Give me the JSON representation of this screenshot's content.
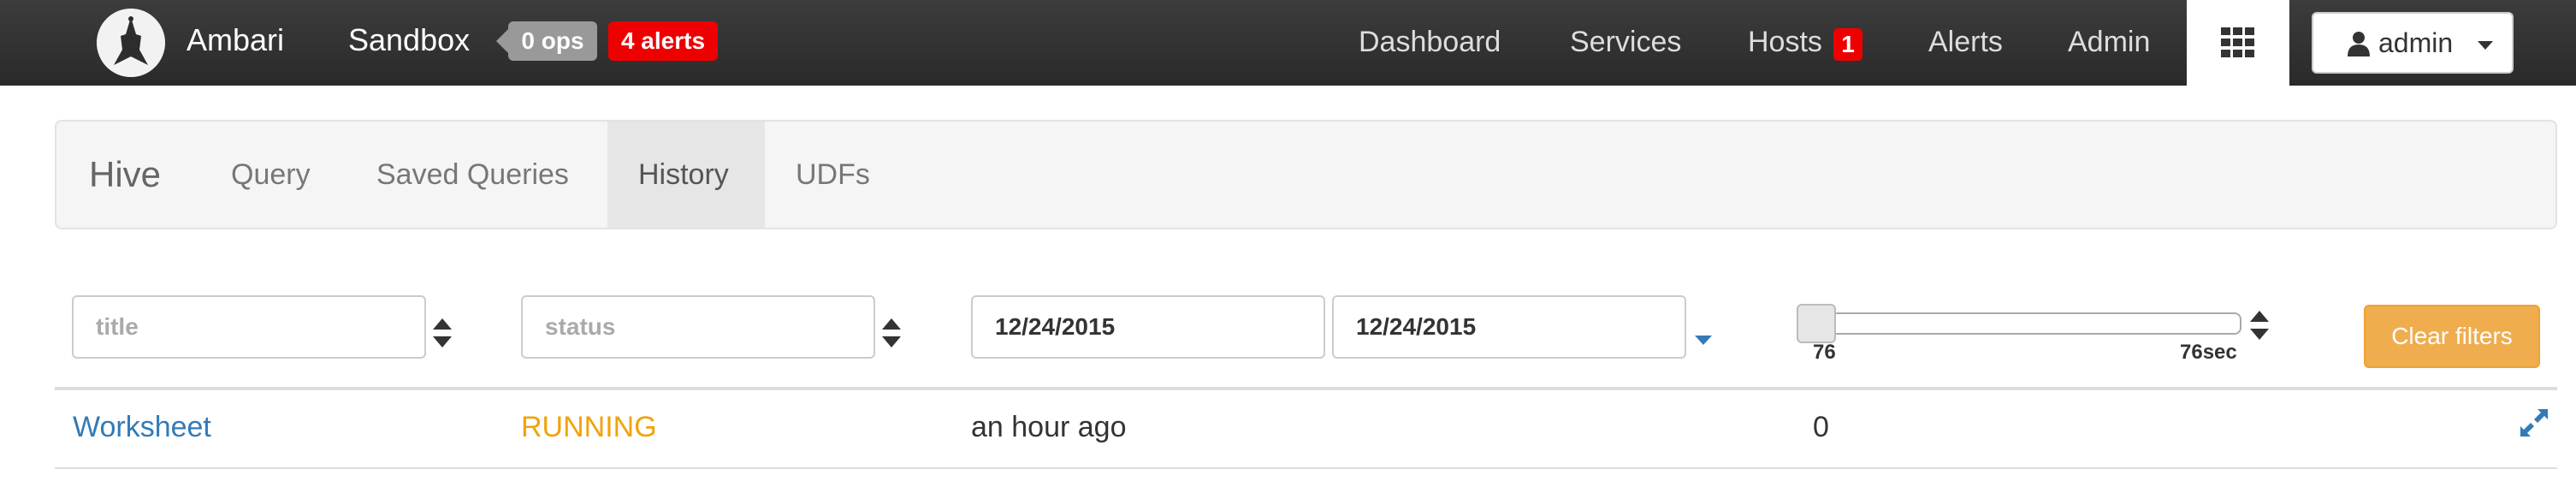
{
  "navbar": {
    "brand": "Ambari",
    "cluster_name": "Sandbox",
    "ops_badge": "0 ops",
    "alerts_badge": "4 alerts",
    "links": {
      "dashboard": "Dashboard",
      "services": "Services",
      "hosts": "Hosts",
      "hosts_badge": "1",
      "alerts": "Alerts",
      "admin": "Admin"
    },
    "grid_icon": "th-grid-icon",
    "user_menu": {
      "icon": "user-icon",
      "label": "admin"
    }
  },
  "subnav": {
    "title": "Hive",
    "tabs": [
      {
        "label": "Query",
        "active": false
      },
      {
        "label": "Saved Queries",
        "active": false
      },
      {
        "label": "History",
        "active": true
      },
      {
        "label": "UDFs",
        "active": false
      }
    ]
  },
  "filters": {
    "title": {
      "placeholder": "title",
      "value": ""
    },
    "status": {
      "placeholder": "status",
      "value": ""
    },
    "date_from": "12/24/2015",
    "date_to": "12/24/2015",
    "duration_slider": {
      "min_label": "76",
      "max_label": "76sec"
    },
    "clear_button": "Clear filters"
  },
  "history_rows": [
    {
      "title": "Worksheet",
      "status": "RUNNING",
      "date": "an hour ago",
      "duration": "0"
    }
  ],
  "colors": {
    "navbar_bg": "#333333",
    "alert_red": "#ee0000",
    "link_blue": "#337ab7",
    "running_orange": "#f0a30a",
    "warning_button": "#f0ad4e"
  }
}
